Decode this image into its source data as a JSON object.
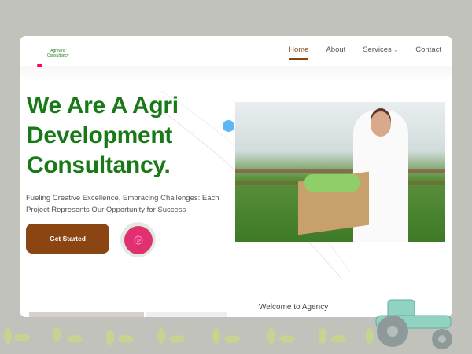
{
  "logo": {
    "line1": "AgriNext",
    "line2": "Consultancy"
  },
  "nav": {
    "items": [
      {
        "label": "Home",
        "active": true
      },
      {
        "label": "About"
      },
      {
        "label": "Services",
        "dropdown": true
      },
      {
        "label": "Contact"
      }
    ]
  },
  "hero": {
    "title_lines": [
      "We Are A Agri",
      "Development",
      "Consultancy."
    ],
    "subtitle": "Fueling Creative Excellence, Embracing Challenges: Each Project Represents Our Opportunity for Success",
    "cta_label": "Get Started",
    "play_icon": "play-icon"
  },
  "next_section": {
    "heading": "Welcome to Agency"
  },
  "colors": {
    "accent": "#8b4513",
    "heading": "#177a17",
    "play": "#e0306f",
    "background": "#c1c2bb"
  }
}
